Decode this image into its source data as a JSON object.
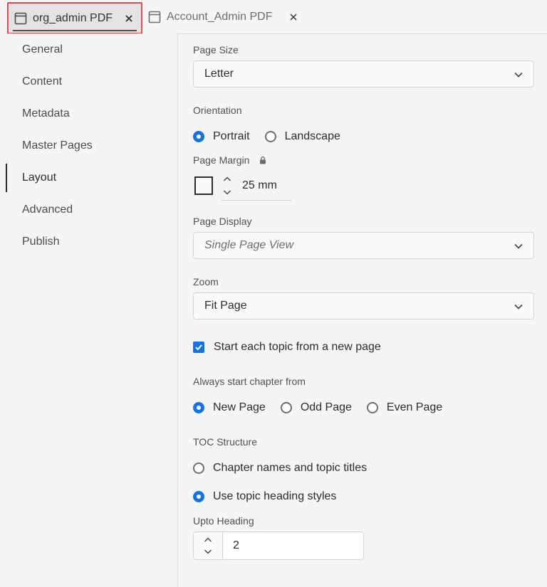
{
  "tabs": [
    {
      "label": "org_admin PDF",
      "active": true
    },
    {
      "label": "Account_Admin PDF",
      "active": false
    }
  ],
  "sidebar": {
    "items": [
      {
        "label": "General"
      },
      {
        "label": "Content"
      },
      {
        "label": "Metadata"
      },
      {
        "label": "Master Pages"
      },
      {
        "label": "Layout",
        "selected": true
      },
      {
        "label": "Advanced"
      },
      {
        "label": "Publish"
      }
    ]
  },
  "layout": {
    "page_size": {
      "label": "Page Size",
      "value": "Letter"
    },
    "orientation": {
      "label": "Orientation",
      "options": [
        {
          "label": "Portrait",
          "selected": true
        },
        {
          "label": "Landscape",
          "selected": false
        }
      ]
    },
    "page_margin": {
      "label": "Page Margin",
      "value": "25 mm"
    },
    "page_display": {
      "label": "Page Display",
      "value": "Single Page View"
    },
    "zoom": {
      "label": "Zoom",
      "value": "Fit Page"
    },
    "start_new_page": {
      "label": "Start each topic from a new page",
      "checked": true
    },
    "chapter_start": {
      "label": "Always start chapter from",
      "options": [
        {
          "label": "New Page",
          "selected": true
        },
        {
          "label": "Odd Page",
          "selected": false
        },
        {
          "label": "Even Page",
          "selected": false
        }
      ]
    },
    "toc_structure": {
      "label": "TOC Structure",
      "options": [
        {
          "label": "Chapter names and topic titles",
          "selected": false
        },
        {
          "label": "Use topic heading styles",
          "selected": true
        }
      ]
    },
    "upto_heading": {
      "label": "Upto Heading",
      "value": "2"
    }
  },
  "colors": {
    "accent": "#1473e6",
    "highlight_border": "#e34850"
  },
  "icons": {
    "tab": "window-icon",
    "close": "close-icon",
    "chevron": "chevron-down-icon",
    "lock": "lock-icon",
    "stepper": "stepper-arrows-icon"
  }
}
